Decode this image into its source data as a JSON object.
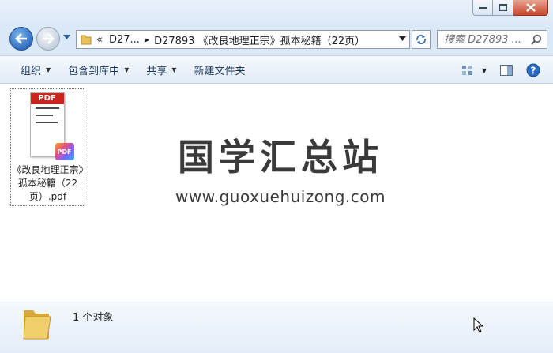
{
  "window": {
    "controls": [
      "minimize",
      "maximize",
      "close"
    ]
  },
  "nav": {
    "back_icon": "back-arrow-icon",
    "forward_icon": "forward-arrow-icon",
    "address": {
      "prefix": "«",
      "crumb_1": "D27...",
      "crumb_2": "D27893 《改良地理正宗》孤本秘籍（22页）"
    },
    "search_placeholder": "搜索 D27893 ..."
  },
  "toolbar": {
    "organize": "组织",
    "include_in_library": "包含到库中",
    "share": "共享",
    "new_folder": "新建文件夹"
  },
  "content": {
    "file": {
      "icon_label": "PDF",
      "badge_label": "PDF",
      "name": "《改良地理正宗》孤本秘籍（22页）.pdf"
    },
    "watermark": {
      "logo": "国学汇总站",
      "url": "www.guoxuehuizong.com"
    }
  },
  "details": {
    "status": "1 个对象"
  },
  "colors": {
    "frame": "#dbe8f6",
    "toolbar_text": "#1e395b",
    "pdf_red": "#c8261f",
    "back_button": "#2f6fc0"
  }
}
